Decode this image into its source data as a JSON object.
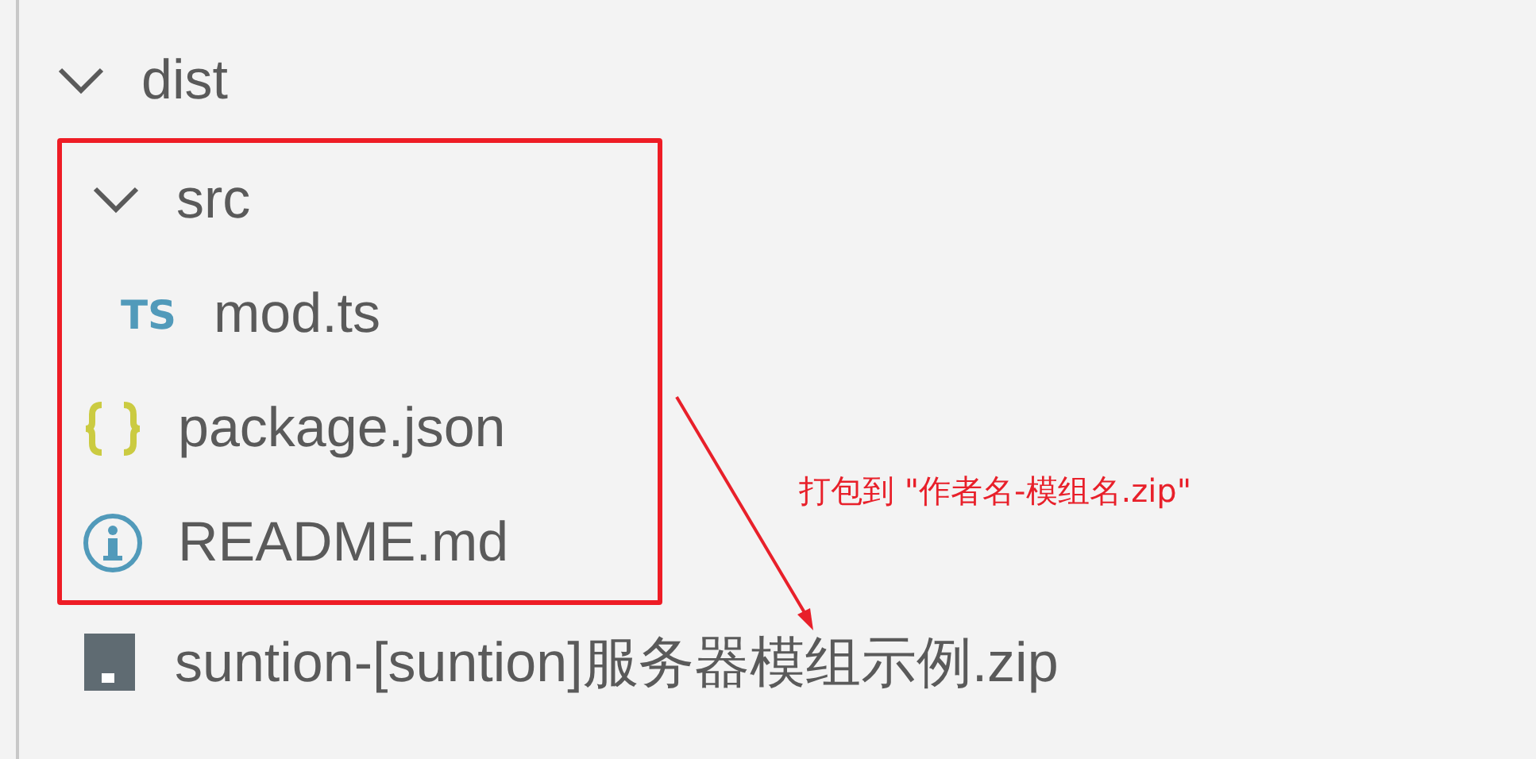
{
  "tree": [
    {
      "name": "dist",
      "kind": "folder",
      "expanded": true,
      "children": [
        {
          "name": "src",
          "kind": "folder",
          "expanded": true,
          "highlighted": true,
          "children": [
            {
              "name": "mod.ts",
              "kind": "ts",
              "icon_label": "TS",
              "highlighted": true
            }
          ]
        },
        {
          "name": "package.json",
          "kind": "json",
          "highlighted": true
        },
        {
          "name": "README.md",
          "kind": "readme",
          "highlighted": true
        },
        {
          "name": "suntion-[suntion]服务器模组示例.zip",
          "kind": "zip"
        }
      ]
    }
  ],
  "annotation": {
    "text": "打包到 \"作者名-模组名.zip\""
  }
}
